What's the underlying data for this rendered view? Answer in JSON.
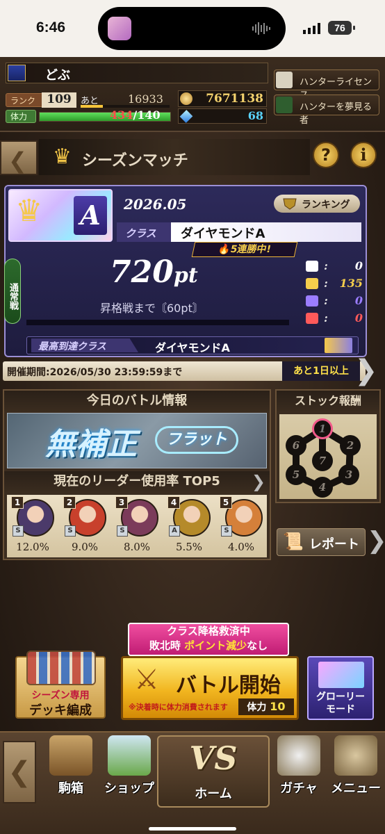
{
  "status_bar": {
    "time": "6:46",
    "battery": "76"
  },
  "player": {
    "name": "どぶ",
    "rank_label": "ランク",
    "rank": "109",
    "next_label": "あと",
    "next_exp": "16933",
    "exp_progress": 0.25,
    "stamina_label": "体力",
    "stamina_current": "434",
    "stamina_sep_max": "/140",
    "coins": "7671138",
    "gems": "68"
  },
  "header_buttons": {
    "license": "ハンターライセンス",
    "aspire": "ハンターを夢見る者"
  },
  "title": "シーズンマッチ",
  "help_glyph": "?",
  "info_glyph": "i",
  "season": {
    "date": "2026.05",
    "ranking_label": "ランキング",
    "class_label": "クラス",
    "class_value": "ダイヤモンドA",
    "class_letter": "A",
    "streak": "5連勝中!",
    "normal_battle": "通常戦",
    "points": "720",
    "points_unit": "pt",
    "promo_text": "昇格戦まで〘60pt〙",
    "best_label": "最高到達クラス",
    "best_value": "ダイヤモンドA",
    "stats": [
      {
        "icon": "bars-icon",
        "value": "0",
        "color": "#ffffff"
      },
      {
        "icon": "gold-crest-icon",
        "value": "135",
        "color": "#f5ce4c"
      },
      {
        "icon": "purple-crest-icon",
        "value": "0",
        "color": "#9b7dff"
      },
      {
        "icon": "red-crest-icon",
        "value": "0",
        "color": "#ff5a5a"
      }
    ]
  },
  "period": {
    "label": "開催期間:2026/05/30 23:59:59まで",
    "remaining": "あと1日以上"
  },
  "battle_info": {
    "title": "今日のバトル情報",
    "rule_main": "無補正",
    "rule_sub": "フラット",
    "top5_title": "現在のリーダー使用率 TOP5",
    "leaders": [
      {
        "rank": "1",
        "rarity": "S",
        "pct": "12.0%",
        "color": "#4b3a6a"
      },
      {
        "rank": "2",
        "rarity": "S",
        "pct": "9.0%",
        "color": "#c8402c"
      },
      {
        "rank": "3",
        "rarity": "S",
        "pct": "8.0%",
        "color": "#7b3b5a"
      },
      {
        "rank": "4",
        "rarity": "A",
        "pct": "5.5%",
        "color": "#b58a2a"
      },
      {
        "rank": "5",
        "rarity": "S",
        "pct": "4.0%",
        "color": "#d5803a"
      }
    ]
  },
  "stock": {
    "title": "ストック報酬",
    "nodes": [
      "1",
      "2",
      "3",
      "4",
      "5",
      "6",
      "7"
    ]
  },
  "report_label": "レポート",
  "rescue": {
    "line1": "クラス降格救済中",
    "line2a": "敗北時 ",
    "line2b": "ポイント減少",
    "line2c": "なし"
  },
  "deck": {
    "line1": "シーズン専用",
    "line2": "デッキ編成"
  },
  "start": {
    "label": "バトル開始",
    "note": "※決着時に体力消費されます",
    "cost_label": "体力",
    "cost_value": "10"
  },
  "glory": {
    "line1": "グローリー",
    "line2": "モード"
  },
  "nav": {
    "items": [
      {
        "label": "駒箱"
      },
      {
        "label": "ショップ"
      },
      {
        "label": "ホーム"
      },
      {
        "label": "ガチャ"
      },
      {
        "label": "メニュー"
      }
    ],
    "vs": "VS"
  }
}
